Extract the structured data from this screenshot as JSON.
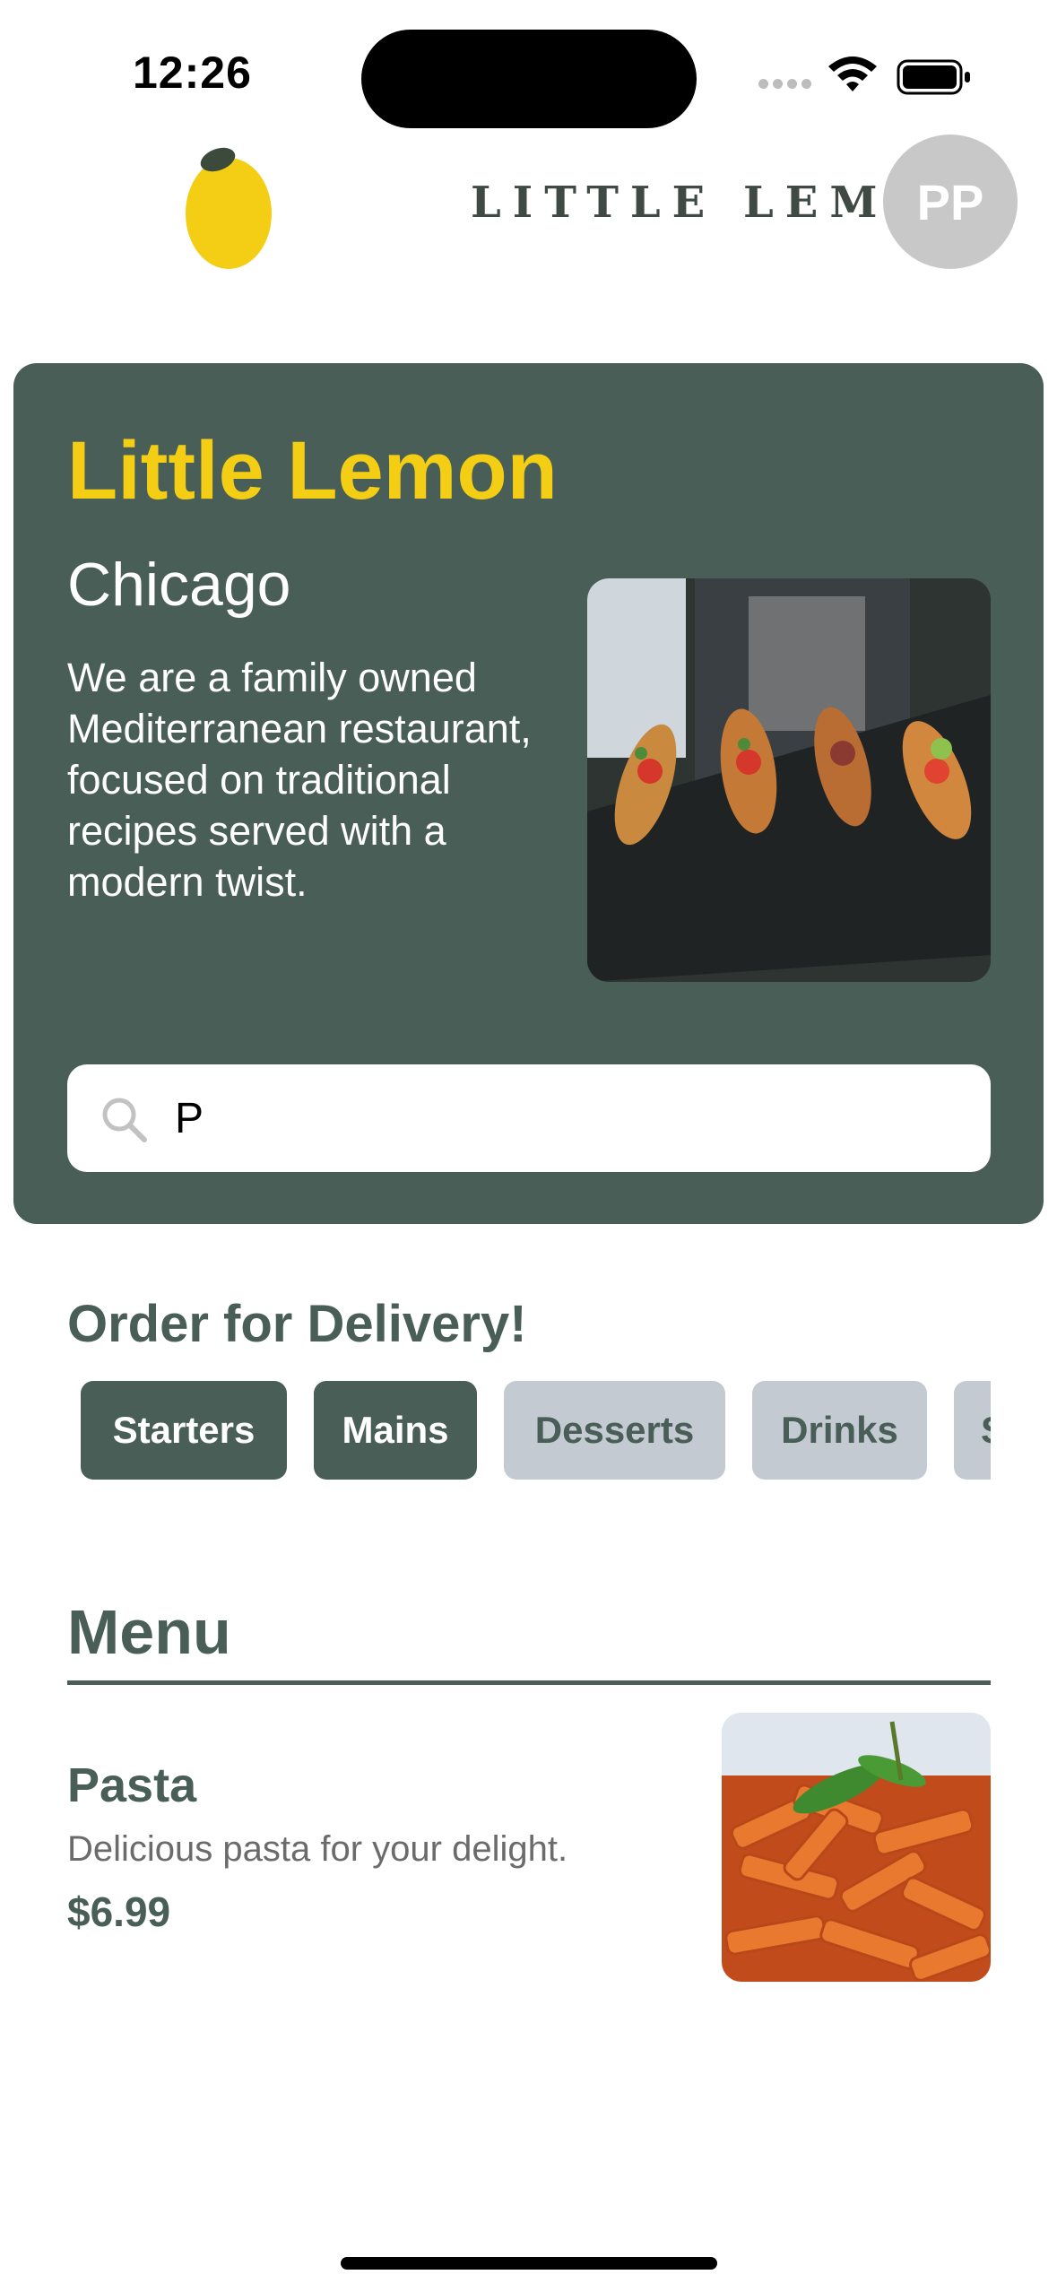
{
  "status_bar": {
    "time": "12:26"
  },
  "header": {
    "logo_text": "LITTLE LEMON",
    "avatar_initials": "PP"
  },
  "hero": {
    "title": "Little Lemon",
    "city": "Chicago",
    "description": "We are a family owned Mediterranean restaurant, focused on traditional recipes served with a modern twist.",
    "search_value": "P"
  },
  "order": {
    "title": "Order for Delivery!",
    "categories": [
      {
        "label": "Starters",
        "active": true
      },
      {
        "label": "Mains",
        "active": true
      },
      {
        "label": "Desserts",
        "active": false
      },
      {
        "label": "Drinks",
        "active": false
      },
      {
        "label": "Specials",
        "active": false
      }
    ]
  },
  "menu": {
    "title": "Menu",
    "items": [
      {
        "name": "Pasta",
        "description": "Delicious pasta for your delight.",
        "price": "$6.99"
      }
    ]
  },
  "colors": {
    "primary": "#495e57",
    "accent": "#f4ce14",
    "chip_inactive": "#c4cad1"
  }
}
